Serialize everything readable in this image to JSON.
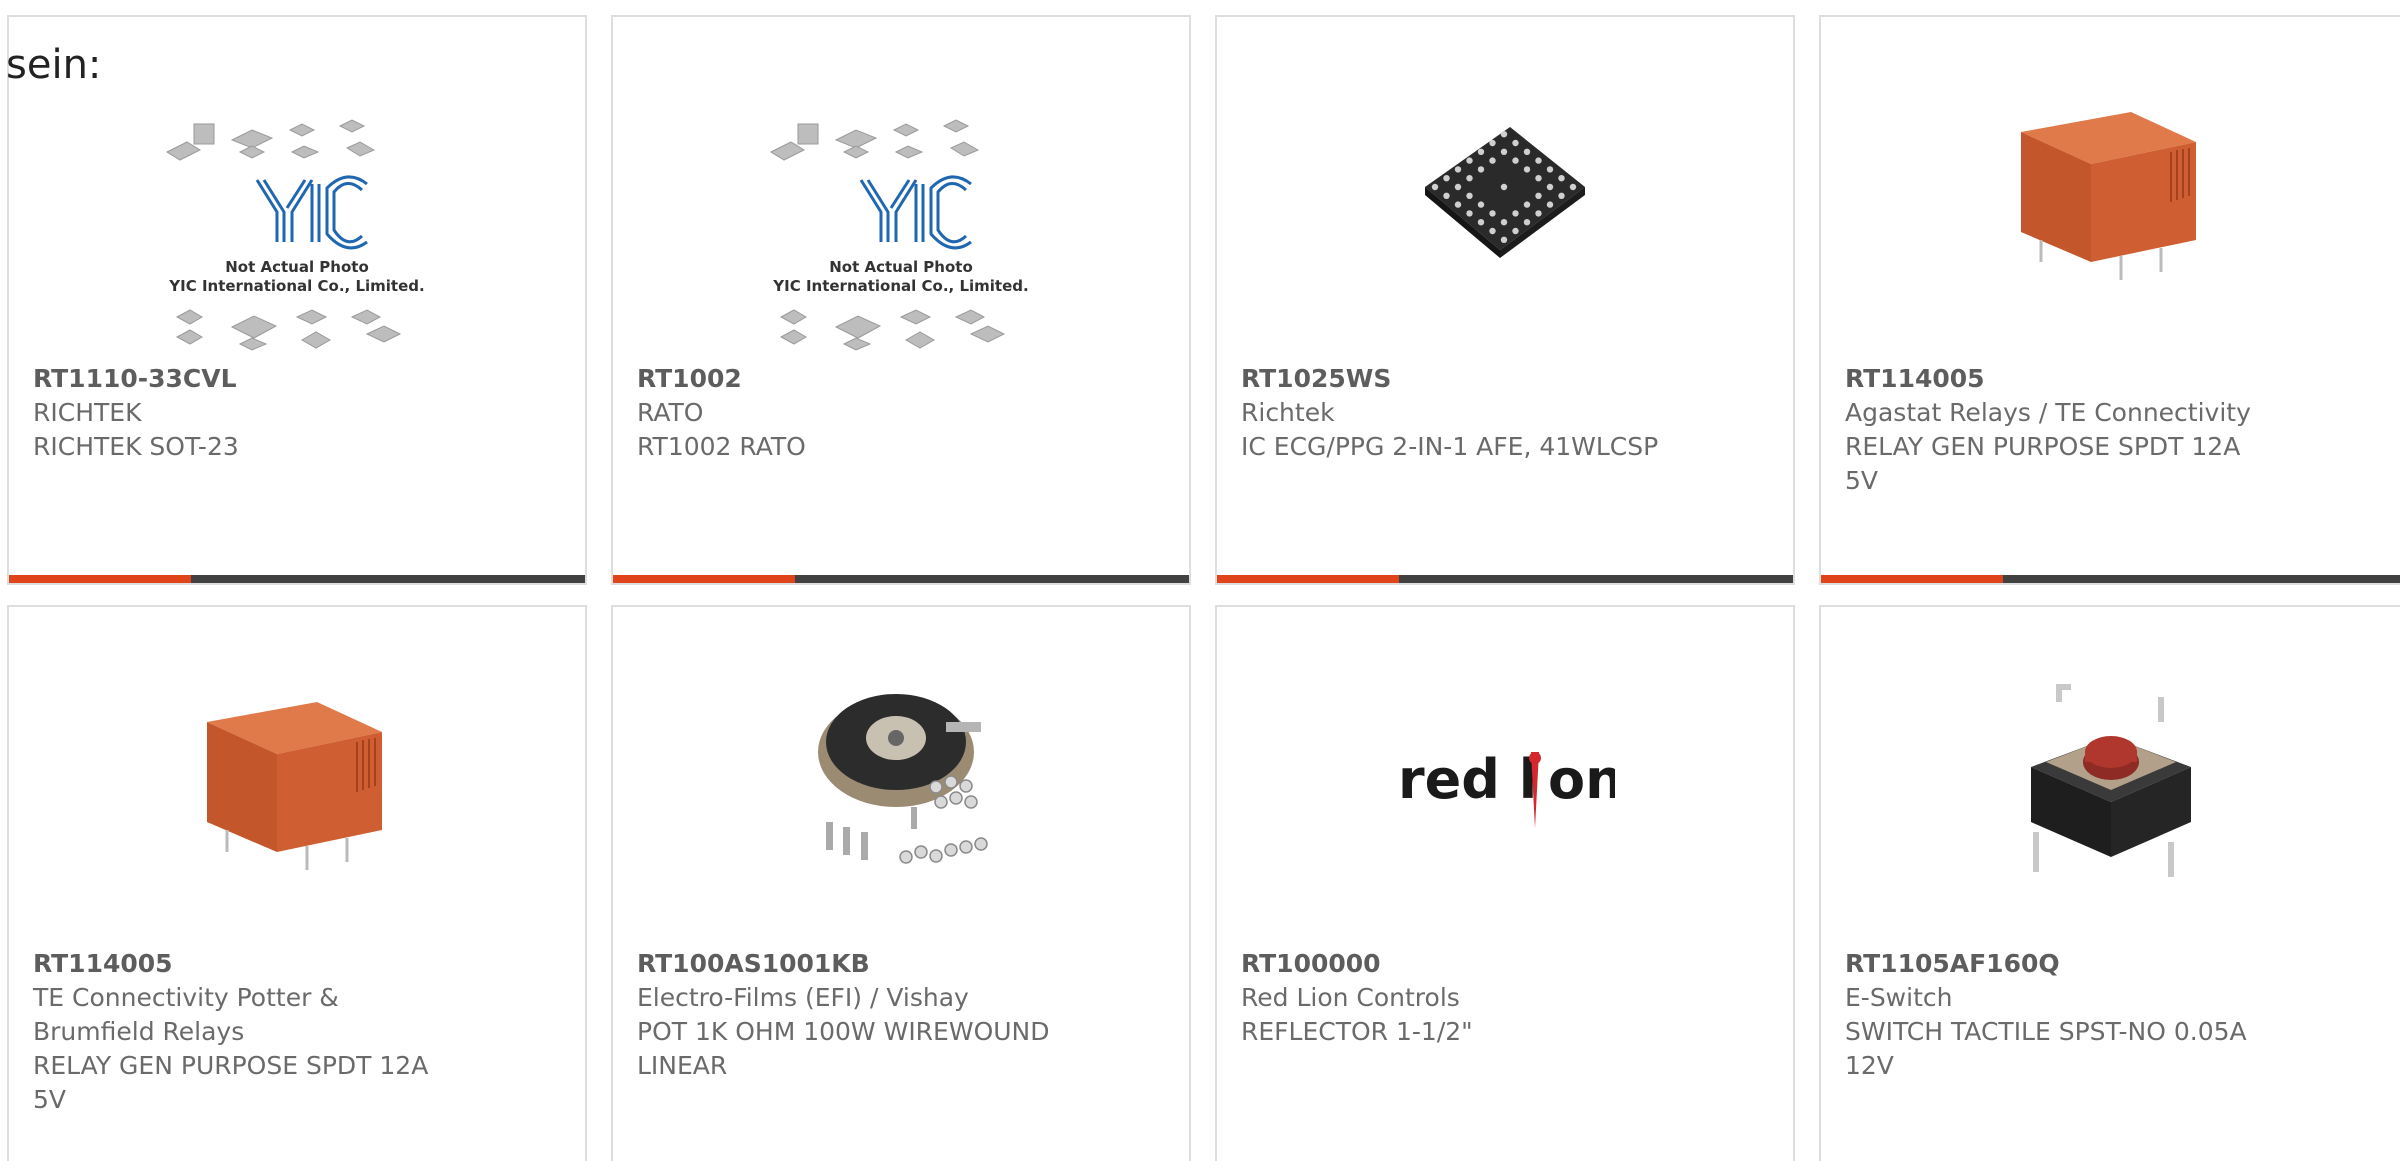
{
  "intro": {
    "text": "sein:"
  },
  "products": [
    {
      "part_number": "RT1110-33CVL",
      "manufacturer": "RICHTEK",
      "description": "RICHTEK SOT-23",
      "image": "yic-placeholder",
      "placeholder_line1": "Not Actual Photo",
      "placeholder_line2": "YIC International Co., Limited."
    },
    {
      "part_number": "RT1002",
      "manufacturer": "RATO",
      "description": "RT1002 RATO",
      "image": "yic-placeholder",
      "placeholder_line1": "Not Actual Photo",
      "placeholder_line2": "YIC International Co., Limited."
    },
    {
      "part_number": "RT1025WS",
      "manufacturer": "Richtek",
      "description": "IC ECG/PPG 2-IN-1 AFE, 41WLCSP",
      "image": "bga-chip"
    },
    {
      "part_number": "RT114005",
      "manufacturer": "Agastat Relays / TE Connectivity",
      "description": "RELAY GEN PURPOSE SPDT 12A 5V",
      "image": "relay"
    },
    {
      "part_number": "RT114005",
      "manufacturer": "TE Connectivity Potter & Brumfield Relays",
      "description": "RELAY GEN PURPOSE SPDT 12A 5V",
      "image": "relay"
    },
    {
      "part_number": "RT100AS1001KB",
      "manufacturer": "Electro-Films (EFI) / Vishay",
      "description": "POT 1K OHM 100W WIREWOUND LINEAR",
      "image": "potentiometer"
    },
    {
      "part_number": "RT100000",
      "manufacturer": "Red Lion Controls",
      "description": "REFLECTOR 1-1/2\"",
      "image": "red-lion-logo",
      "logo_text_a": "red l",
      "logo_text_b": "on"
    },
    {
      "part_number": "RT1105AF160Q",
      "manufacturer": "E-Switch",
      "description": "SWITCH TACTILE SPST-NO 0.05A 12V",
      "image": "tactile-switch"
    }
  ],
  "colors": {
    "accent": "#e0441a",
    "bar": "#414141",
    "border": "#dedede",
    "relay": "#cc5a2c",
    "logo_red": "#d5282e"
  }
}
